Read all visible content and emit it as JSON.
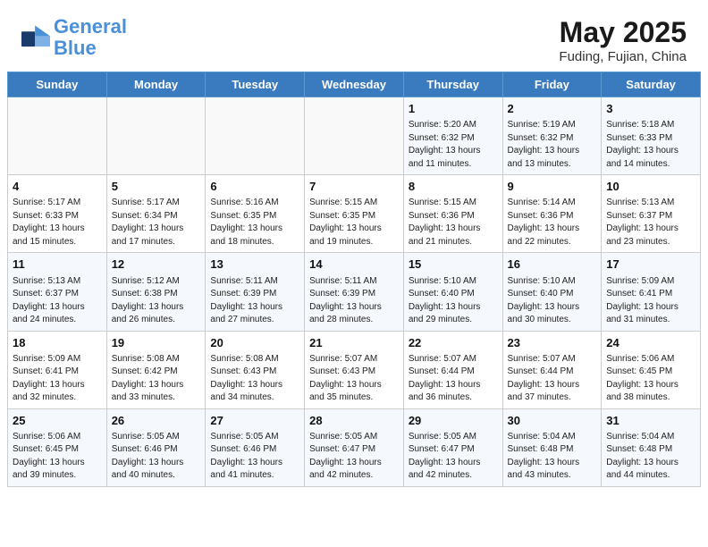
{
  "header": {
    "logo_line1": "General",
    "logo_line2": "Blue",
    "month_year": "May 2025",
    "location": "Fuding, Fujian, China"
  },
  "weekdays": [
    "Sunday",
    "Monday",
    "Tuesday",
    "Wednesday",
    "Thursday",
    "Friday",
    "Saturday"
  ],
  "weeks": [
    [
      {
        "day": "",
        "info": ""
      },
      {
        "day": "",
        "info": ""
      },
      {
        "day": "",
        "info": ""
      },
      {
        "day": "",
        "info": ""
      },
      {
        "day": "1",
        "info": "Sunrise: 5:20 AM\nSunset: 6:32 PM\nDaylight: 13 hours\nand 11 minutes."
      },
      {
        "day": "2",
        "info": "Sunrise: 5:19 AM\nSunset: 6:32 PM\nDaylight: 13 hours\nand 13 minutes."
      },
      {
        "day": "3",
        "info": "Sunrise: 5:18 AM\nSunset: 6:33 PM\nDaylight: 13 hours\nand 14 minutes."
      }
    ],
    [
      {
        "day": "4",
        "info": "Sunrise: 5:17 AM\nSunset: 6:33 PM\nDaylight: 13 hours\nand 15 minutes."
      },
      {
        "day": "5",
        "info": "Sunrise: 5:17 AM\nSunset: 6:34 PM\nDaylight: 13 hours\nand 17 minutes."
      },
      {
        "day": "6",
        "info": "Sunrise: 5:16 AM\nSunset: 6:35 PM\nDaylight: 13 hours\nand 18 minutes."
      },
      {
        "day": "7",
        "info": "Sunrise: 5:15 AM\nSunset: 6:35 PM\nDaylight: 13 hours\nand 19 minutes."
      },
      {
        "day": "8",
        "info": "Sunrise: 5:15 AM\nSunset: 6:36 PM\nDaylight: 13 hours\nand 21 minutes."
      },
      {
        "day": "9",
        "info": "Sunrise: 5:14 AM\nSunset: 6:36 PM\nDaylight: 13 hours\nand 22 minutes."
      },
      {
        "day": "10",
        "info": "Sunrise: 5:13 AM\nSunset: 6:37 PM\nDaylight: 13 hours\nand 23 minutes."
      }
    ],
    [
      {
        "day": "11",
        "info": "Sunrise: 5:13 AM\nSunset: 6:37 PM\nDaylight: 13 hours\nand 24 minutes."
      },
      {
        "day": "12",
        "info": "Sunrise: 5:12 AM\nSunset: 6:38 PM\nDaylight: 13 hours\nand 26 minutes."
      },
      {
        "day": "13",
        "info": "Sunrise: 5:11 AM\nSunset: 6:39 PM\nDaylight: 13 hours\nand 27 minutes."
      },
      {
        "day": "14",
        "info": "Sunrise: 5:11 AM\nSunset: 6:39 PM\nDaylight: 13 hours\nand 28 minutes."
      },
      {
        "day": "15",
        "info": "Sunrise: 5:10 AM\nSunset: 6:40 PM\nDaylight: 13 hours\nand 29 minutes."
      },
      {
        "day": "16",
        "info": "Sunrise: 5:10 AM\nSunset: 6:40 PM\nDaylight: 13 hours\nand 30 minutes."
      },
      {
        "day": "17",
        "info": "Sunrise: 5:09 AM\nSunset: 6:41 PM\nDaylight: 13 hours\nand 31 minutes."
      }
    ],
    [
      {
        "day": "18",
        "info": "Sunrise: 5:09 AM\nSunset: 6:41 PM\nDaylight: 13 hours\nand 32 minutes."
      },
      {
        "day": "19",
        "info": "Sunrise: 5:08 AM\nSunset: 6:42 PM\nDaylight: 13 hours\nand 33 minutes."
      },
      {
        "day": "20",
        "info": "Sunrise: 5:08 AM\nSunset: 6:43 PM\nDaylight: 13 hours\nand 34 minutes."
      },
      {
        "day": "21",
        "info": "Sunrise: 5:07 AM\nSunset: 6:43 PM\nDaylight: 13 hours\nand 35 minutes."
      },
      {
        "day": "22",
        "info": "Sunrise: 5:07 AM\nSunset: 6:44 PM\nDaylight: 13 hours\nand 36 minutes."
      },
      {
        "day": "23",
        "info": "Sunrise: 5:07 AM\nSunset: 6:44 PM\nDaylight: 13 hours\nand 37 minutes."
      },
      {
        "day": "24",
        "info": "Sunrise: 5:06 AM\nSunset: 6:45 PM\nDaylight: 13 hours\nand 38 minutes."
      }
    ],
    [
      {
        "day": "25",
        "info": "Sunrise: 5:06 AM\nSunset: 6:45 PM\nDaylight: 13 hours\nand 39 minutes."
      },
      {
        "day": "26",
        "info": "Sunrise: 5:05 AM\nSunset: 6:46 PM\nDaylight: 13 hours\nand 40 minutes."
      },
      {
        "day": "27",
        "info": "Sunrise: 5:05 AM\nSunset: 6:46 PM\nDaylight: 13 hours\nand 41 minutes."
      },
      {
        "day": "28",
        "info": "Sunrise: 5:05 AM\nSunset: 6:47 PM\nDaylight: 13 hours\nand 42 minutes."
      },
      {
        "day": "29",
        "info": "Sunrise: 5:05 AM\nSunset: 6:47 PM\nDaylight: 13 hours\nand 42 minutes."
      },
      {
        "day": "30",
        "info": "Sunrise: 5:04 AM\nSunset: 6:48 PM\nDaylight: 13 hours\nand 43 minutes."
      },
      {
        "day": "31",
        "info": "Sunrise: 5:04 AM\nSunset: 6:48 PM\nDaylight: 13 hours\nand 44 minutes."
      }
    ]
  ]
}
